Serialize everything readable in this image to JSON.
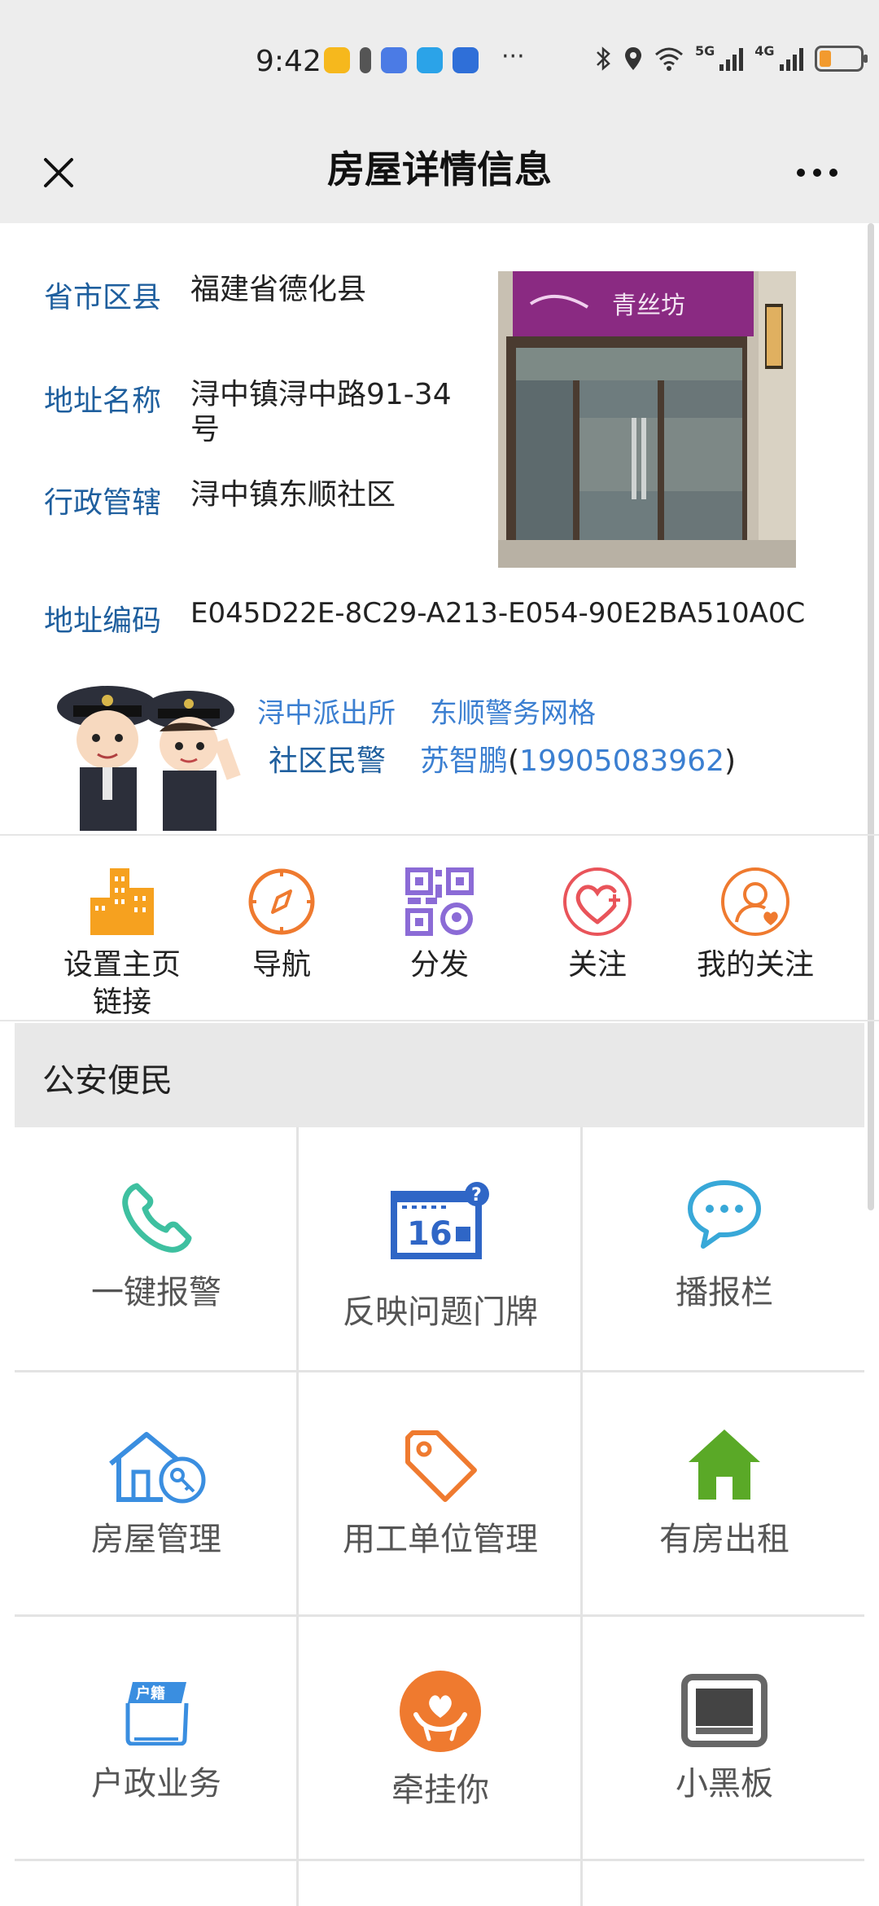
{
  "status_bar": {
    "time": "9:42",
    "dots": "···",
    "network_5g": "5G",
    "network_4g": "4G"
  },
  "header": {
    "title": "房屋详情信息"
  },
  "info": {
    "province_label": "省市区县",
    "province_value": "福建省德化县",
    "address_label": "地址名称",
    "address_value_line1": "浔中镇浔中路91-34",
    "address_value_line2": "号",
    "admin_label": "行政管辖",
    "admin_value": "浔中镇东顺社区",
    "code_label": "地址编码",
    "code_value": "E045D22E-8C29-A213-E054-90E2BA510A0C",
    "photo_sign": "青丝坊"
  },
  "police": {
    "station": "浔中派出所",
    "grid": "东顺警务网格",
    "community_label": "社区民警",
    "officer_name": "苏智鹏",
    "paren_open": "(",
    "officer_phone": "19905083962",
    "paren_close": ")"
  },
  "actions": [
    {
      "label_line1": "设置主页",
      "label_line2": "链接",
      "icon": "buildings-icon"
    },
    {
      "label_line1": "导航",
      "label_line2": "",
      "icon": "compass-icon"
    },
    {
      "label_line1": "分发",
      "label_line2": "",
      "icon": "qrcode-icon"
    },
    {
      "label_line1": "关注",
      "label_line2": "",
      "icon": "heart-plus-icon"
    },
    {
      "label_line1": "我的关注",
      "label_line2": "",
      "icon": "user-heart-icon"
    }
  ],
  "section": {
    "title": "公安便民"
  },
  "grid": [
    {
      "label": "一键报警",
      "icon": "phone-icon"
    },
    {
      "label": "反映问题门牌",
      "icon": "doorplate-icon",
      "plate_number": "16"
    },
    {
      "label": "播报栏",
      "icon": "chat-bubble-icon"
    },
    {
      "label": "房屋管理",
      "icon": "house-key-icon"
    },
    {
      "label": "用工单位管理",
      "icon": "tag-icon"
    },
    {
      "label": "有房出租",
      "icon": "green-house-icon"
    },
    {
      "label": "户政业务",
      "icon": "household-register-icon",
      "badge_text": "户籍"
    },
    {
      "label": "牵挂你",
      "icon": "hands-heart-icon"
    },
    {
      "label": "小黑板",
      "icon": "blackboard-icon"
    }
  ],
  "colors": {
    "label_blue": "#1f5f9e",
    "link_blue": "#3b7fd1",
    "accent_orange": "#ef7a2f",
    "qr_purple": "#8b6bd6",
    "heart_red": "#e9545a",
    "green": "#5aa927"
  }
}
